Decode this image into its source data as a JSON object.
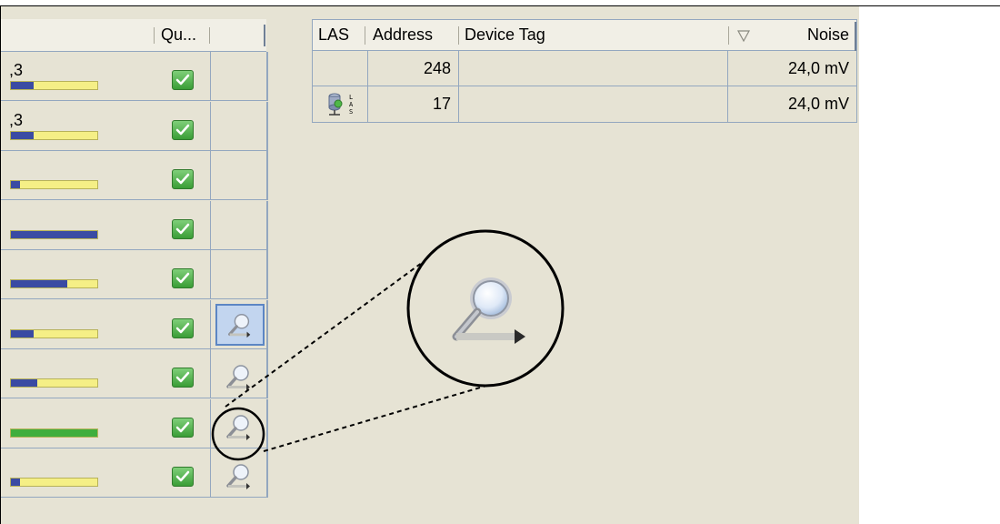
{
  "left_table": {
    "header_quality": "Qu...",
    "rows": [
      {
        "value": ",3",
        "fill_pct": 26,
        "fill_color": "#3a4ba3",
        "quality": "ok",
        "diagnose": "none"
      },
      {
        "value": ",3",
        "fill_pct": 26,
        "fill_color": "#3a4ba3",
        "quality": "ok",
        "diagnose": "none"
      },
      {
        "value": "",
        "fill_pct": 10,
        "fill_color": "#3a4ba3",
        "quality": "ok",
        "diagnose": "none"
      },
      {
        "value": "",
        "fill_pct": 100,
        "fill_color": "#3a4ba3",
        "quality": "ok",
        "diagnose": "none"
      },
      {
        "value": "",
        "fill_pct": 65,
        "fill_color": "#3a4ba3",
        "quality": "ok",
        "diagnose": "none"
      },
      {
        "value": "",
        "fill_pct": 26,
        "fill_color": "#3a4ba3",
        "quality": "ok",
        "diagnose": "selected"
      },
      {
        "value": "",
        "fill_pct": 30,
        "fill_color": "#3a4ba3",
        "quality": "ok",
        "diagnose": "normal"
      },
      {
        "value": "",
        "fill_pct": 100,
        "fill_color": "#3fae3d",
        "quality": "ok",
        "diagnose": "circled"
      },
      {
        "value": "",
        "fill_pct": 10,
        "fill_color": "#3a4ba3",
        "quality": "ok",
        "diagnose": "normal"
      }
    ]
  },
  "right_table": {
    "headers": {
      "las": "LAS",
      "address": "Address",
      "device_tag": "Device Tag",
      "noise": "Noise"
    },
    "sort_icon": "sort-descending-icon",
    "rows": [
      {
        "las": "",
        "address": "248",
        "device_tag": "",
        "noise": "24,0 mV"
      },
      {
        "las": "las-device-icon",
        "address": "17",
        "device_tag": "",
        "noise": "24,0 mV"
      }
    ]
  },
  "colors": {
    "panel_bg": "#e6e3d4",
    "grid_line": "#93a7bf",
    "bar_yellow": "#f5ef86",
    "check_green": "#3a9d36",
    "selection_blue": "#c2d5ef"
  },
  "zoom_callout": {
    "icon": "magnifier-diagnose-icon"
  }
}
